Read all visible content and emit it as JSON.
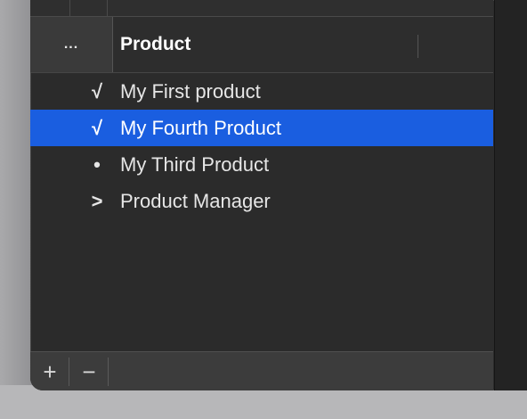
{
  "header": {
    "toggle_label": "...",
    "column_title": "Product"
  },
  "items": [
    {
      "marker": "√",
      "label": "My First product",
      "selected": false
    },
    {
      "marker": "√",
      "label": "My Fourth Product",
      "selected": true
    },
    {
      "marker": "•",
      "label": "My Third Product",
      "selected": false
    },
    {
      "marker": ">",
      "label": "Product Manager",
      "selected": false
    }
  ],
  "footer": {
    "add_label": "+",
    "remove_label": "−"
  },
  "colors": {
    "selection": "#1a5ee0",
    "background": "#2b2b2b"
  }
}
